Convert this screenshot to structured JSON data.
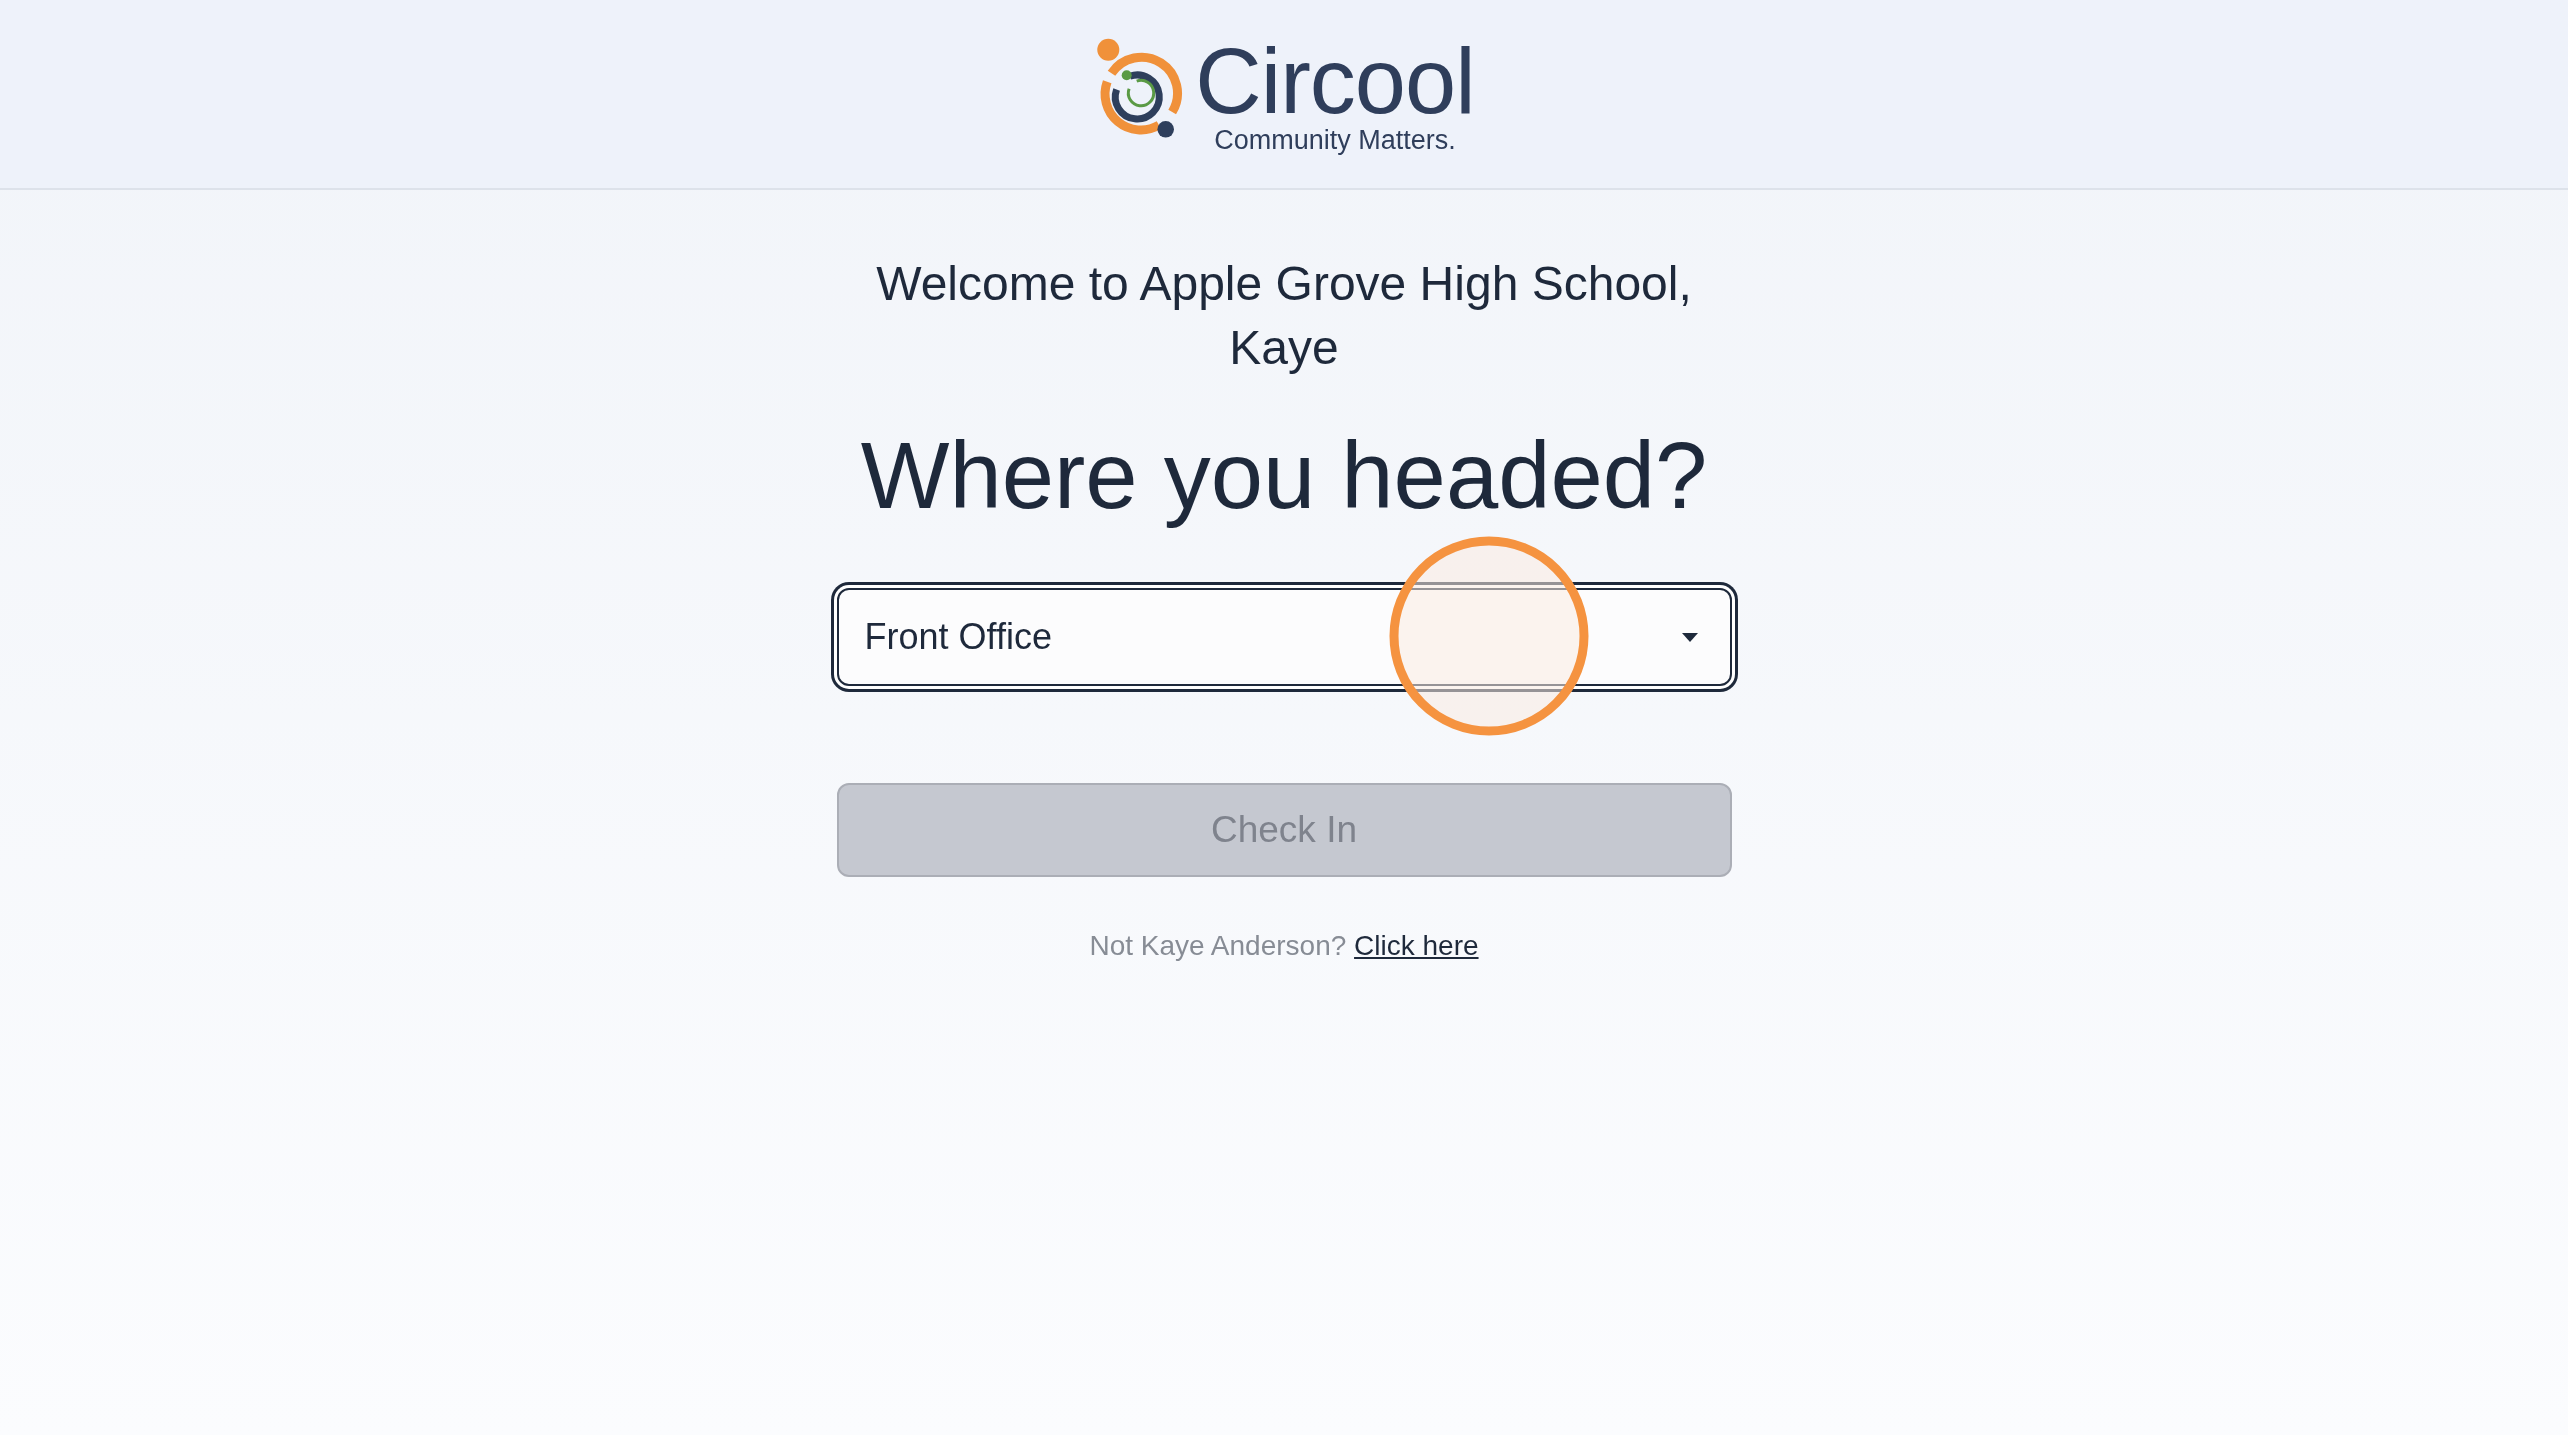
{
  "header": {
    "brand": "Circool",
    "tagline": "Community Matters."
  },
  "welcome": "Welcome to Apple Grove High School, Kaye",
  "question": "Where you headed?",
  "destination_select": {
    "value": "Front Office",
    "focused": true
  },
  "check_in_button": {
    "label": "Check In",
    "disabled": true
  },
  "account_prompt": {
    "text": "Not Kaye Anderson?",
    "link": "Click here"
  }
}
